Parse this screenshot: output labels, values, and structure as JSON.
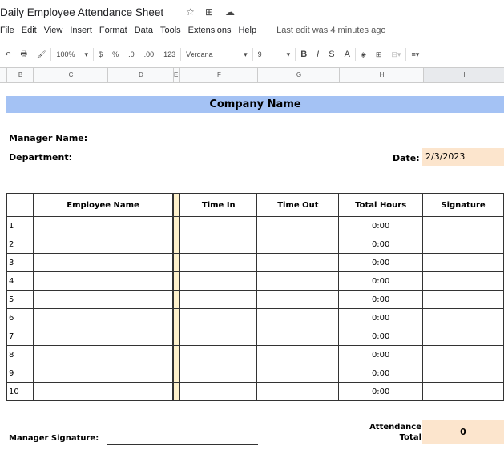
{
  "app": {
    "title": "Daily Employee Attendance Sheet",
    "icons": [
      "star-icon",
      "move-folder-icon",
      "cloud-status-icon"
    ]
  },
  "menu": [
    "File",
    "Edit",
    "View",
    "Insert",
    "Format",
    "Data",
    "Tools",
    "Extensions",
    "Help"
  ],
  "last_edit": "Last edit was 4 minutes ago",
  "toolbar": {
    "zoom": "100%",
    "currency": "$",
    "percent": "%",
    "dec_less": ".0",
    "dec_more": ".00",
    "format": "123",
    "font": "Verdana",
    "size": "9",
    "bold": "B",
    "italic": "I",
    "strike": "S",
    "textcolor": "A"
  },
  "columns": [
    "B",
    "C",
    "D",
    "E",
    "F",
    "G",
    "H",
    "I"
  ],
  "sheet": {
    "company": "Company Name",
    "manager_label": "Manager Name:",
    "department_label": "Department:",
    "date_label": "Date:",
    "date_value": "2/3/2023",
    "headers": [
      "Employee Name",
      "Time In",
      "Time Out",
      "Total Hours",
      "Signature"
    ],
    "rows": [
      {
        "n": "1",
        "hours": "0:00"
      },
      {
        "n": "2",
        "hours": "0:00"
      },
      {
        "n": "3",
        "hours": "0:00"
      },
      {
        "n": "4",
        "hours": "0:00"
      },
      {
        "n": "5",
        "hours": "0:00"
      },
      {
        "n": "6",
        "hours": "0:00"
      },
      {
        "n": "7",
        "hours": "0:00"
      },
      {
        "n": "8",
        "hours": "0:00"
      },
      {
        "n": "9",
        "hours": "0:00"
      },
      {
        "n": "10",
        "hours": "0:00"
      }
    ],
    "manager_signature_label": "Manager Signature:",
    "attendance_label_1": "Attendance",
    "attendance_label_2": "Total",
    "attendance_total": "0"
  },
  "colors": {
    "company_bg": "#a4c2f4",
    "date_bg": "#fce5cd",
    "divider_bg": "#fff2cc"
  }
}
